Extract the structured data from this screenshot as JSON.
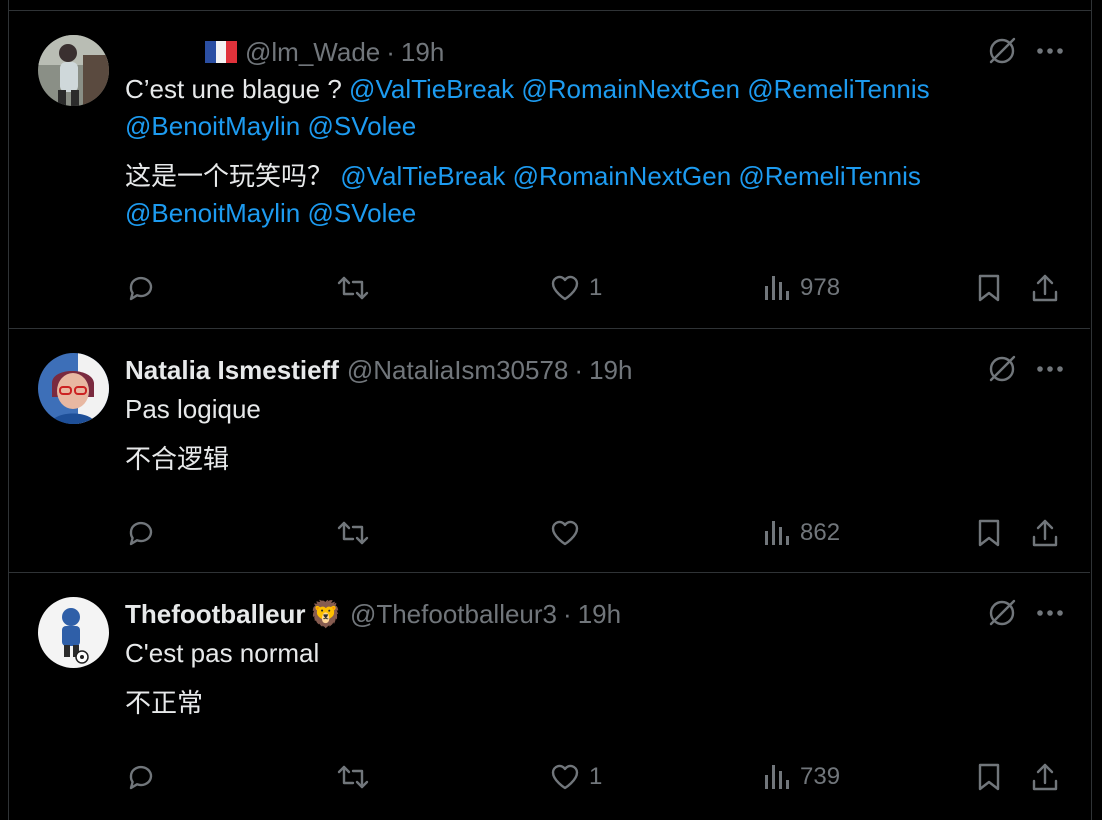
{
  "colors": {
    "background": "#000000",
    "text": "#e7e9ea",
    "muted": "#71767b",
    "link": "#1d9bf0",
    "border": "#2f3336"
  },
  "tweets": [
    {
      "name": "",
      "handle": "@lm_Wade",
      "time": "19h",
      "flag": "france-flag",
      "text1_plain": "C’est une blague ? ",
      "text1_mentions_line1": "@ValTieBreak @RomainNextGen @RemeliTennis",
      "text1_mentions_line2": "@BenoitMaylin @SVolee",
      "text2_plain": "这是一个玩笑吗？ ",
      "text2_mentions_line1": "@ValTieBreak @RomainNextGen @RemeliTennis",
      "text2_mentions_line2": "@BenoitMaylin @SVolee",
      "replies": "",
      "reposts": "",
      "likes": "1",
      "views": "978"
    },
    {
      "name": "Natalia Ismestieff",
      "handle": "@NataliaIsm30578",
      "time": "19h",
      "text1": "Pas logique",
      "text2": "不合逻辑",
      "replies": "",
      "reposts": "",
      "likes": "",
      "views": "862"
    },
    {
      "name": "Thefootballeur",
      "name_emoji": "🦁",
      "handle": "@Thefootballeur3",
      "time": "19h",
      "text1": "C'est pas normal",
      "text2": "不正常",
      "replies": "",
      "reposts": "",
      "likes": "1",
      "views": "739"
    }
  ],
  "separator": "·",
  "icons": [
    "reply-icon",
    "repost-icon",
    "like-icon",
    "views-icon",
    "bookmark-icon",
    "share-icon",
    "grok-icon",
    "more-icon"
  ]
}
